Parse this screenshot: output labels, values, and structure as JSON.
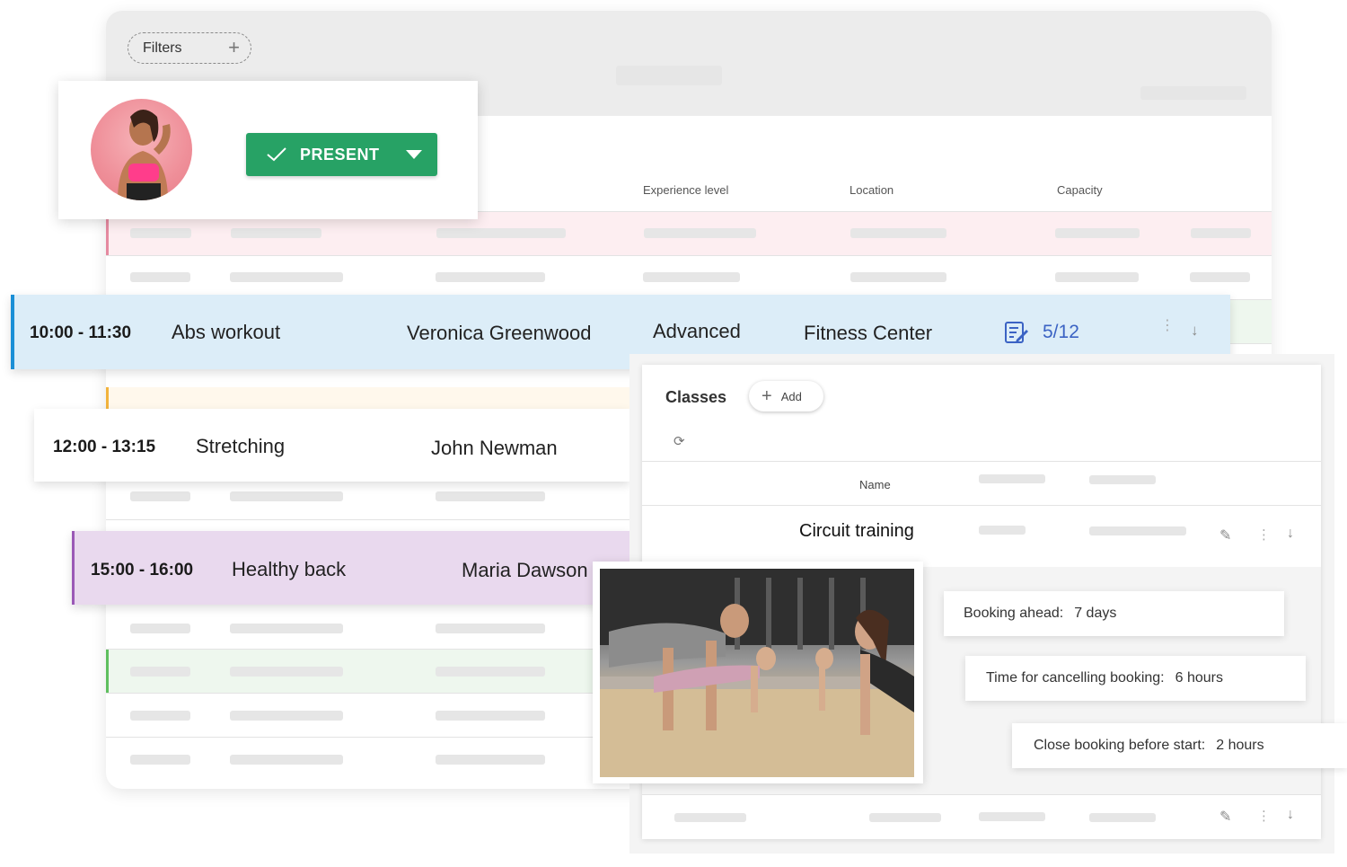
{
  "toolbar": {
    "filters_label": "Filters"
  },
  "table": {
    "columns": {
      "experience": "Experience level",
      "location": "Location",
      "capacity": "Capacity"
    }
  },
  "present_card": {
    "status_label": "PRESENT"
  },
  "classes_rows": [
    {
      "time": "10:00 - 11:30",
      "name": "Abs workout",
      "trainer": "Veronica Greenwood",
      "level": "Advanced",
      "location": "Fitness Center",
      "capacity": "5/12",
      "accent": "#1b8fd6",
      "bg": "#dcedf8"
    },
    {
      "time": "12:00 - 13:15",
      "name": "Stretching",
      "trainer": "John Newman",
      "bg": "#ffffff"
    },
    {
      "time": "15:00 - 16:00",
      "name": "Healthy back",
      "trainer": "Maria Dawson",
      "accent": "#9b59b6",
      "bg": "#e9d9ee"
    }
  ],
  "classes_panel": {
    "title": "Classes",
    "add_label": "Add",
    "name_column": "Name",
    "selected_class": "Circuit training"
  },
  "booking_info": [
    {
      "label": "Booking ahead:",
      "value": "7 days"
    },
    {
      "label": "Time for cancelling booking:",
      "value": "6 hours"
    },
    {
      "label": "Close booking before start:",
      "value": "2 hours"
    }
  ],
  "colors": {
    "present_green": "#27a265",
    "capacity_blue": "#3b63c4",
    "pink_row": "#fdeef1",
    "green_row": "#eef7ee",
    "orange_row": "#fff8ec"
  }
}
